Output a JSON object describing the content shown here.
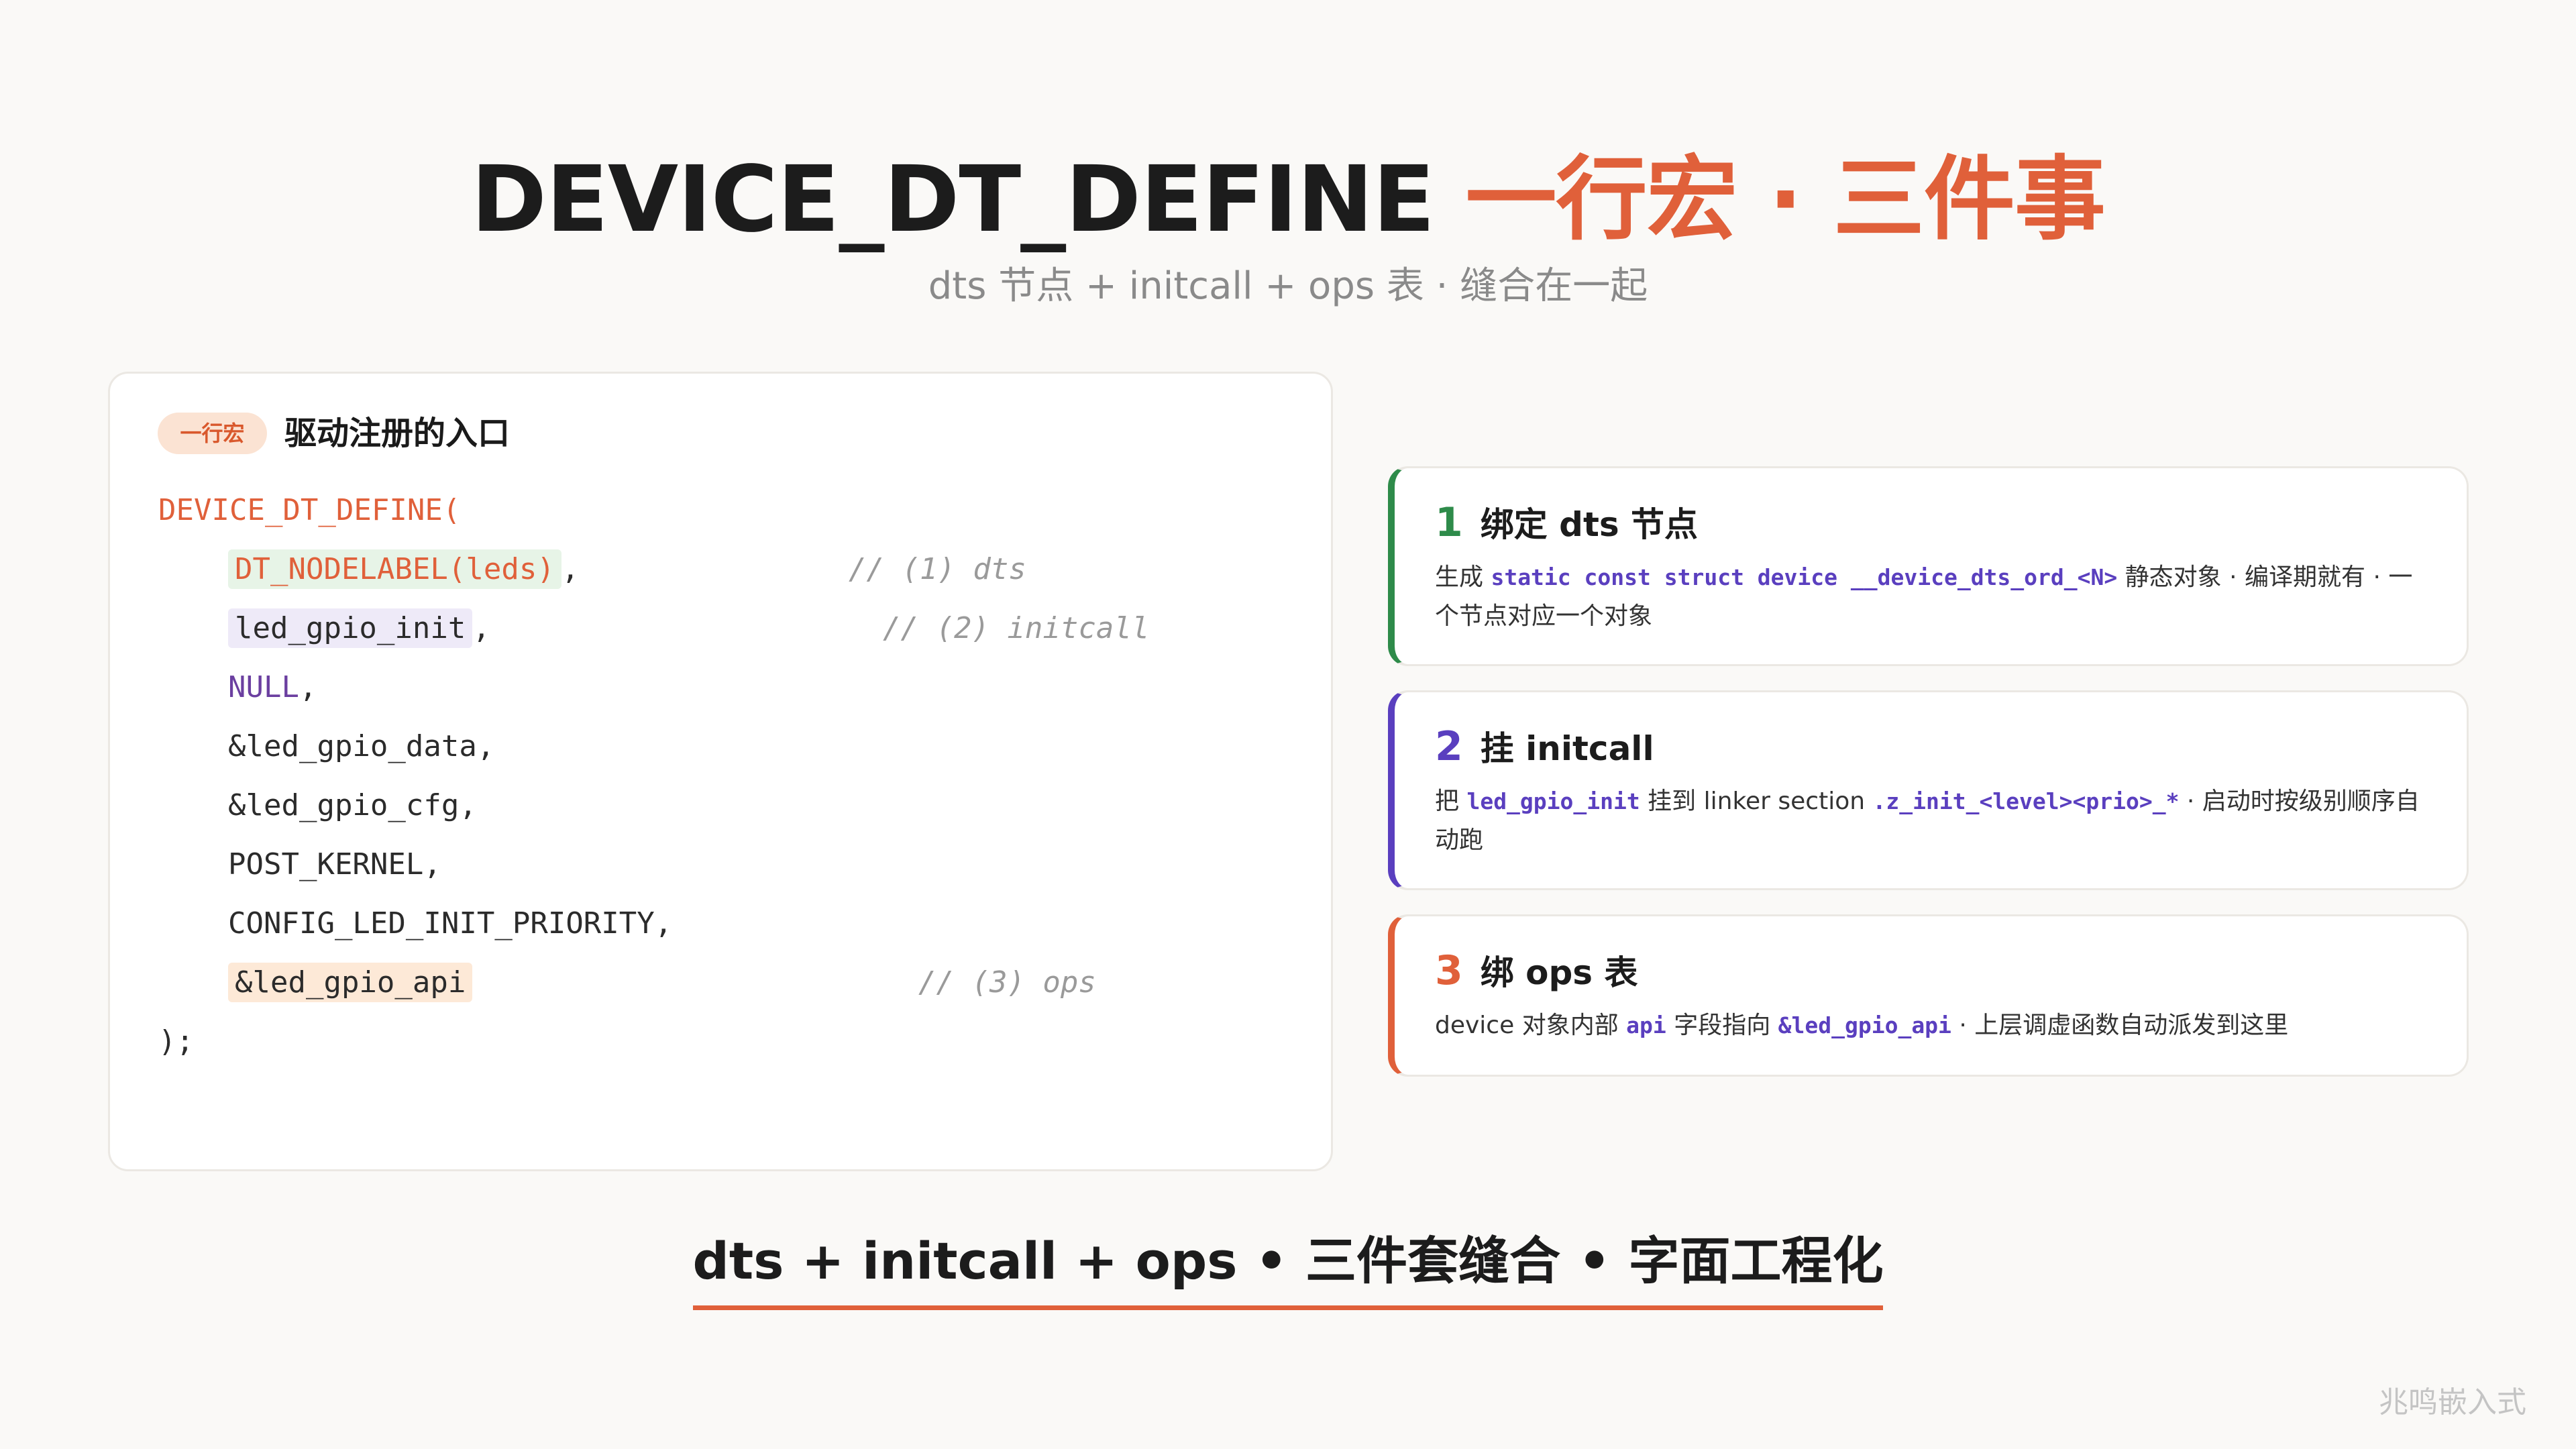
{
  "header": {
    "title_main": "DEVICE_DT_DEFINE ",
    "title_accent": "一行宏 · 三件事",
    "subtitle": "dts 节点 + initcall + ops 表 · 缝合在一起"
  },
  "code_card": {
    "pill": "一行宏",
    "heading": "驱动注册的入口",
    "lines": {
      "open": "DEVICE_DT_DEFINE(",
      "l1_code": "DT_NODELABEL(leds)",
      "l1_suffix": ",",
      "l1_comment": "// (1) dts",
      "l2_code": "led_gpio_init",
      "l2_suffix": ",",
      "l2_comment": "// (2) initcall",
      "l3": "NULL",
      "l3_suffix": ",",
      "l4": "&led_gpio_data,",
      "l5": "&led_gpio_cfg,",
      "l6": "POST_KERNEL,",
      "l7": "CONFIG_LED_INIT_PRIORITY,",
      "l8_code": "&led_gpio_api",
      "l8_comment": "// (3) ops",
      "close": ");"
    }
  },
  "steps": [
    {
      "num": "1",
      "title": "绑定 dts 节点",
      "desc_a": "生成 ",
      "desc_code1": "static const struct device __device_dts_ord_<N>",
      "desc_b": " 静态对象 · 编译期就有 · 一个节点对应一个对象"
    },
    {
      "num": "2",
      "title": "挂 initcall",
      "desc_a": "把 ",
      "desc_code1": "led_gpio_init",
      "desc_b": " 挂到 linker section ",
      "desc_code2": ".z_init_<level><prio>_*",
      "desc_c": " · 启动时按级别顺序自动跑"
    },
    {
      "num": "3",
      "title": "绑 ops 表",
      "desc_a": "device 对象内部 ",
      "desc_code1": "api",
      "desc_b": " 字段指向 ",
      "desc_code2": "&led_gpio_api",
      "desc_c": " · 上层调虚函数自动派发到这里"
    }
  ],
  "footer": {
    "summary": "dts + initcall + ops • 三件套缝合 • 字面工程化",
    "watermark": "兆鸣嵌入式"
  },
  "colors": {
    "accent": "#e0603a",
    "green": "#2e8b4a",
    "purple": "#5a3fbf",
    "background": "#faf9f7"
  }
}
